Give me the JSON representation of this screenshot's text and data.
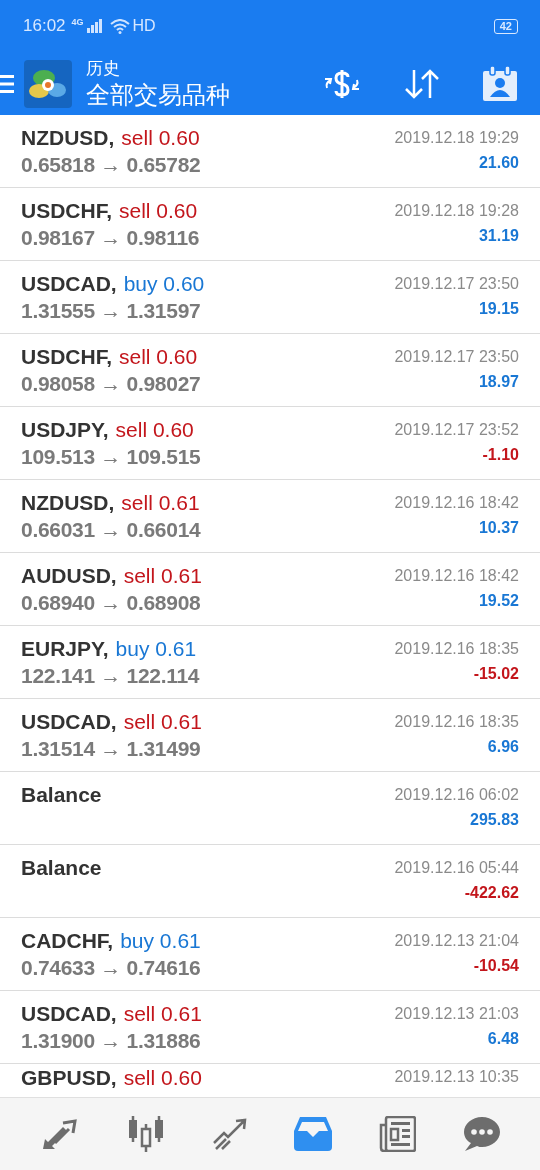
{
  "status_bar": {
    "time": "16:02",
    "network": "4G",
    "hd": "HD",
    "battery": "42"
  },
  "header": {
    "title": "历史",
    "subtitle": "全部交易品种"
  },
  "deals": [
    {
      "kind": "trade",
      "symbol": "NZDUSD,",
      "order": "sell 0.60",
      "is_buy": false,
      "prices": "0.65818 → 0.65782",
      "time": "2019.12.18 19:29",
      "profit": "21.60",
      "loss": false
    },
    {
      "kind": "trade",
      "symbol": "USDCHF,",
      "order": "sell 0.60",
      "is_buy": false,
      "prices": "0.98167 → 0.98116",
      "time": "2019.12.18 19:28",
      "profit": "31.19",
      "loss": false
    },
    {
      "kind": "trade",
      "symbol": "USDCAD,",
      "order": "buy 0.60",
      "is_buy": true,
      "prices": "1.31555 → 1.31597",
      "time": "2019.12.17 23:50",
      "profit": "19.15",
      "loss": false
    },
    {
      "kind": "trade",
      "symbol": "USDCHF,",
      "order": "sell 0.60",
      "is_buy": false,
      "prices": "0.98058 → 0.98027",
      "time": "2019.12.17 23:50",
      "profit": "18.97",
      "loss": false
    },
    {
      "kind": "trade",
      "symbol": "USDJPY,",
      "order": "sell 0.60",
      "is_buy": false,
      "prices": "109.513 → 109.515",
      "time": "2019.12.17 23:52",
      "profit": "-1.10",
      "loss": true
    },
    {
      "kind": "trade",
      "symbol": "NZDUSD,",
      "order": "sell 0.61",
      "is_buy": false,
      "prices": "0.66031 → 0.66014",
      "time": "2019.12.16 18:42",
      "profit": "10.37",
      "loss": false
    },
    {
      "kind": "trade",
      "symbol": "AUDUSD,",
      "order": "sell 0.61",
      "is_buy": false,
      "prices": "0.68940 → 0.68908",
      "time": "2019.12.16 18:42",
      "profit": "19.52",
      "loss": false
    },
    {
      "kind": "trade",
      "symbol": "EURJPY,",
      "order": "buy 0.61",
      "is_buy": true,
      "prices": "122.141 → 122.114",
      "time": "2019.12.16 18:35",
      "profit": "-15.02",
      "loss": true
    },
    {
      "kind": "trade",
      "symbol": "USDCAD,",
      "order": "sell 0.61",
      "is_buy": false,
      "prices": "1.31514 → 1.31499",
      "time": "2019.12.16 18:35",
      "profit": "6.96",
      "loss": false
    },
    {
      "kind": "balance",
      "symbol": "Balance",
      "time": "2019.12.16 06:02",
      "profit": "295.83",
      "loss": false
    },
    {
      "kind": "balance",
      "symbol": "Balance",
      "time": "2019.12.16 05:44",
      "profit": "-422.62",
      "loss": true
    },
    {
      "kind": "trade",
      "symbol": "CADCHF,",
      "order": "buy 0.61",
      "is_buy": true,
      "prices": "0.74633 → 0.74616",
      "time": "2019.12.13 21:04",
      "profit": "-10.54",
      "loss": true
    },
    {
      "kind": "trade",
      "symbol": "USDCAD,",
      "order": "sell 0.61",
      "is_buy": false,
      "prices": "1.31900 → 1.31886",
      "time": "2019.12.13 21:03",
      "profit": "6.48",
      "loss": false
    },
    {
      "kind": "partial",
      "symbol": "GBPUSD,",
      "order": "sell 0.60",
      "is_buy": false,
      "time": "2019.12.13 10:35"
    }
  ],
  "nav": [
    {
      "kind": "trade",
      "selected": false
    },
    {
      "kind": "quotes",
      "selected": false
    },
    {
      "kind": "chart",
      "selected": false
    },
    {
      "kind": "history",
      "selected": true
    },
    {
      "kind": "news",
      "selected": false
    },
    {
      "kind": "chat",
      "selected": false
    }
  ]
}
